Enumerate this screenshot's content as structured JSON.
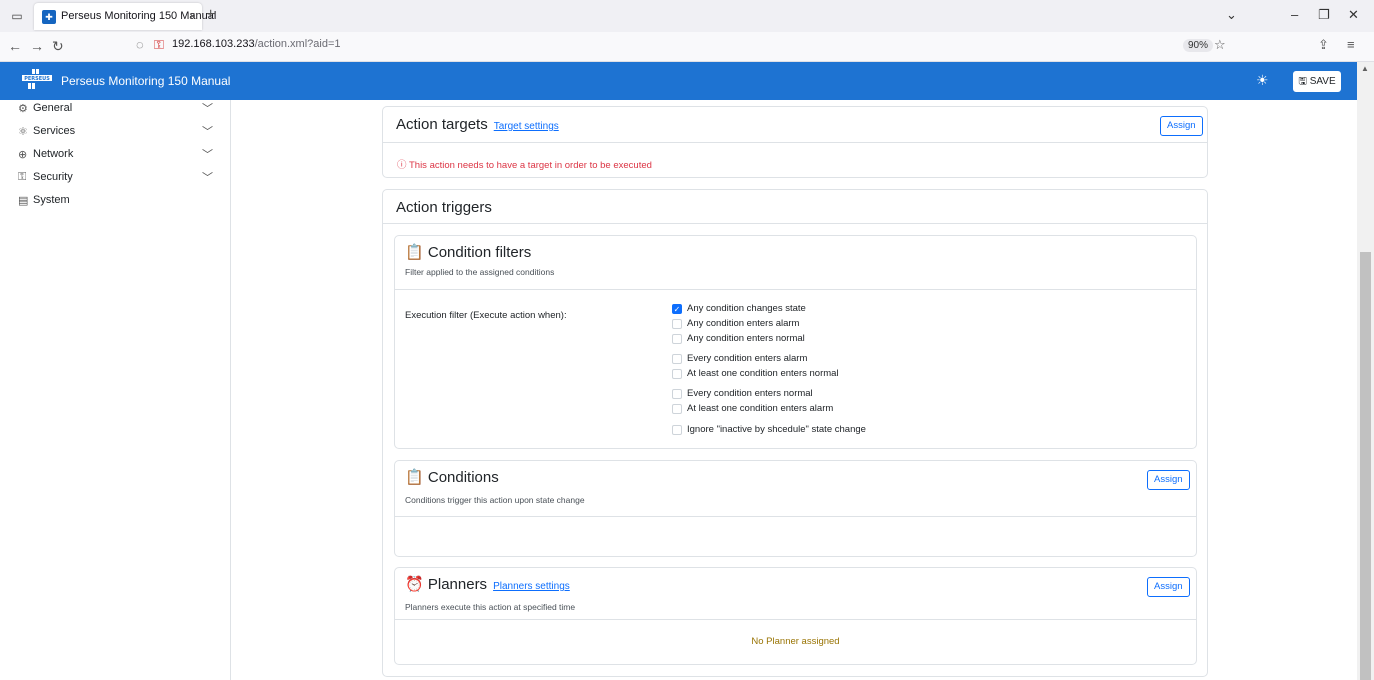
{
  "browser": {
    "tab_title": "Perseus Monitoring 150 Manual",
    "tab_close": "×",
    "new_tab": "+",
    "url_host": "192.168.103.233",
    "url_path": "/action.xml?aid=1",
    "zoom": "90%"
  },
  "app": {
    "logo_text": "PERSEUS",
    "title": "Perseus Monitoring 150 Manual",
    "save_label": "SAVE",
    "accent_color": "#1e73d2"
  },
  "sidebar": {
    "items": [
      {
        "label": "General",
        "icon": "gear-icon",
        "expandable": true
      },
      {
        "label": "Services",
        "icon": "services-icon",
        "expandable": true
      },
      {
        "label": "Network",
        "icon": "globe-icon",
        "expandable": true
      },
      {
        "label": "Security",
        "icon": "lock-icon",
        "expandable": true
      },
      {
        "label": "System",
        "icon": "document-icon",
        "expandable": false
      }
    ]
  },
  "targets": {
    "title": "Action targets",
    "link": "Target settings",
    "assign": "Assign",
    "warning": "This action needs to have a target in order to be executed"
  },
  "triggers": {
    "title": "Action triggers",
    "filters": {
      "title": "Condition filters",
      "subtitle": "Filter applied to the assigned conditions",
      "label": "Execution filter (Execute action when):",
      "options": [
        {
          "label": "Any condition changes state",
          "checked": true
        },
        {
          "label": "Any condition enters alarm",
          "checked": false
        },
        {
          "label": "Any condition enters normal",
          "checked": false
        },
        {
          "label": "Every condition enters alarm",
          "checked": false
        },
        {
          "label": "At least one condition enters normal",
          "checked": false
        },
        {
          "label": "Every condition enters normal",
          "checked": false
        },
        {
          "label": "At least one condition enters alarm",
          "checked": false
        },
        {
          "label": "Ignore \"inactive by shcedule\" state change",
          "checked": false
        }
      ]
    },
    "conditions": {
      "title": "Conditions",
      "subtitle": "Conditions trigger this action upon state change",
      "assign": "Assign"
    },
    "planners": {
      "title": "Planners",
      "link": "Planners settings",
      "subtitle": "Planners execute this action at specified time",
      "assign": "Assign",
      "empty": "No Planner assigned"
    }
  }
}
